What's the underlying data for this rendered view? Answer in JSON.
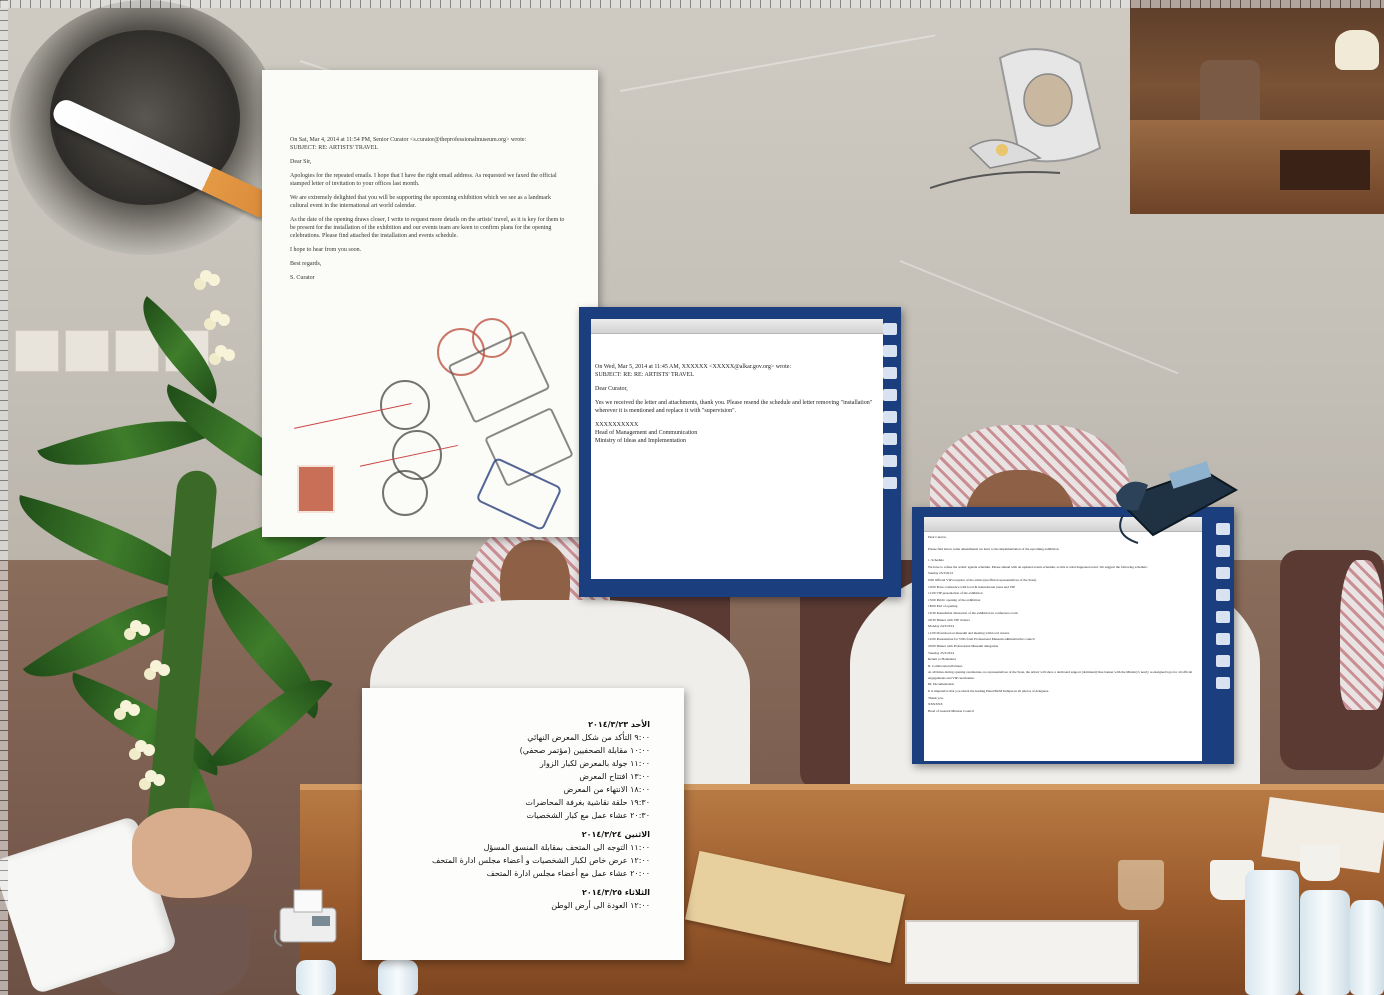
{
  "letter": {
    "header": "On Sat, Mar 4, 2014 at 11:54 PM, Senior Curator <s.curator@theprofessionalmuseum.org> wrote:",
    "subject": "SUBJECT: RE: ARTISTS' TRAVEL",
    "salutation": "Dear Sir,",
    "p1": "Apologies for the repeated emails. I hope that I have the right email address. As requested we faxed the official stamped letter of invitation to your offices last month.",
    "p2": "We are extremely delighted that you will be supporting the upcoming exhibition which we see as a landmark cultural event in the international art world calendar.",
    "p3": "As the date of the opening draws closer, I write to request more details on the artists' travel, as it is key for them to be present for the installation of the exhibition and our events team are keen to confirm plans for the opening celebrations. Please find attached the installation and events schedule.",
    "p4": "I hope to hear from you soon.",
    "closing": "Best regards,",
    "signature": "S. Curator"
  },
  "email1": {
    "header": "On Wed, Mar 5, 2014 at 11:45 AM, XXXXXX <XXXXX@alkar.gov.org> wrote:",
    "subject": "SUBJECT: RE: RE: ARTISTS' TRAVEL",
    "salutation": "Dear Curator,",
    "body": "Yes we received the letter and attachments, thank you. Please resend the schedule and letter removing \"installation\" wherever it is mentioned and replace it with \"supervision\".",
    "sig_name": "XXXXXXXXXX",
    "sig_title": "Head of Management and Communication",
    "sig_org": "Ministry of Ideas and Implementation"
  },
  "email2": {
    "salutation": "Dear Curator,",
    "intro": "Please find below some amendments we have to the implementation of the upcoming exhibition.",
    "sections": [
      "1. Schedule",
      "We have to refuse the artists' agenda schedule. Please amend with an updated events schedule, as this is what happened event. We suggest the following schedule:",
      "Sunday 23/3/2014",
      "9:00 Official VIP reception of the artists (unofficial representatives of the State)",
      "10:00 Press conference with local & international press and VIP",
      "11:00 VIP presentation of the exhibition",
      "13:00 Public opening of the exhibition",
      "18:00 End of opening",
      "19:30 Roundtable discussion of the exhibition in conference room",
      "20:30 Dinner with VIP visitors",
      "Monday 24/3/2014",
      "11:00 Download on museum and meeting with local curator",
      "12:00 Presentation for VIPs from Professional Museum administrative council",
      "20:00 Dinner with Professional Museum delegation",
      "Tuesday 25/3/2014",
      "Return to Homeland",
      "II. Collaborators/Partners",
      "At all times during opening ceremonies, no representatives of the State, the artists' will show a dedicated support (dominant) blue banner with the Ministry's newly re-designed logo for all official engagements and VIP ceremonies.",
      "III. Documentation",
      "It is imperative that you attach the leading Panel/MoM Indiqua in all photos of delegates.",
      "Thank you.",
      "XXXXXX",
      "Head of General Mission Council"
    ]
  },
  "schedule": {
    "days": [
      {
        "title": "الأحد ٢٠١٤/٣/٢٣",
        "items": [
          "٩:٠٠ التأكد من شكل المعرض النهائي",
          "١٠:٠٠ مقابلة الصحفيين (مؤتمر صحفي)",
          "١١:٠٠ جولة بالمعرض لكبار الزوار",
          "١٣:٠٠ افتتاح المعرض",
          "١٨:٠٠ الانتهاء من المعرض",
          "١٩:٣٠ حلقة نقاشية بغرفة المحاضرات",
          "٢٠:٣٠ عشاء عمل مع كبار الشخصيات"
        ]
      },
      {
        "title": "الاثنين ٢٠١٤/٣/٢٤",
        "items": [
          "١١:٠٠ التوجه الى المتحف بمقابلة المنسق المسؤل",
          "١٢:٠٠ عرض خاص لكبار الشخصيات و أعضاء مجلس ادارة المتحف",
          "٢٠:٠٠ عشاء عمل مع أعضاء مجلس ادارة المتحف"
        ]
      },
      {
        "title": "الثلاثاء ٢٠١٤/٣/٢٥",
        "items": [
          "١٢:٠٠ العودة الى أرض الوطن"
        ]
      }
    ]
  },
  "colors": {
    "stamp_red": "#b84a3a",
    "stamp_blue": "#2b3e7a",
    "desktop_blue": "#1b3f7e"
  }
}
